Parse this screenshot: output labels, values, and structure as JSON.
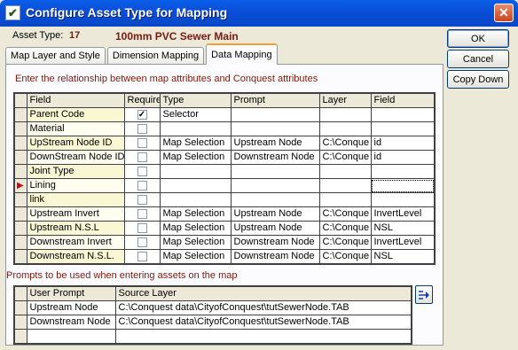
{
  "window": {
    "title": "Configure Asset Type for Mapping",
    "close_glyph": "✕",
    "icon": "checkmark-app-icon"
  },
  "asset": {
    "label": "Asset Type:",
    "code": "17",
    "name": "100mm PVC Sewer Main"
  },
  "tabs": [
    {
      "label": "Map Layer and Style",
      "active": false
    },
    {
      "label": "Dimension Mapping",
      "active": false
    },
    {
      "label": "Data Mapping",
      "active": true
    }
  ],
  "mapping_section": {
    "heading": "Enter the relationship between map attributes and Conquest attributes",
    "columns": [
      "Field",
      "Require",
      "Type",
      "Prompt",
      "Layer",
      "Field"
    ],
    "rows": [
      {
        "field": "Parent Code",
        "required": true,
        "type": "Selector",
        "prompt": "",
        "layer": "",
        "map_field": ""
      },
      {
        "field": "Material",
        "required": false,
        "type": "",
        "prompt": "",
        "layer": "",
        "map_field": ""
      },
      {
        "field": "UpStream Node ID",
        "required": false,
        "type": "Map Selection",
        "prompt": "Upstream Node",
        "layer": "C:\\Conque",
        "map_field": "id"
      },
      {
        "field": "DownStream Node ID",
        "required": false,
        "type": "Map Selection",
        "prompt": "Downstream Node",
        "layer": "C:\\Conque",
        "map_field": "id"
      },
      {
        "field": "Joint Type",
        "required": false,
        "type": "",
        "prompt": "",
        "layer": "",
        "map_field": ""
      },
      {
        "field": "Lining",
        "required": false,
        "type": "",
        "prompt": "",
        "layer": "",
        "map_field": "",
        "current": true
      },
      {
        "field": "link",
        "required": false,
        "type": "",
        "prompt": "",
        "layer": "",
        "map_field": ""
      },
      {
        "field": "Upstream Invert",
        "required": false,
        "type": "Map Selection",
        "prompt": "Upstream Node",
        "layer": "C:\\Conque",
        "map_field": "InvertLevel"
      },
      {
        "field": "Upstream N.S.L",
        "required": false,
        "type": "Map Selection",
        "prompt": "Upstream Node",
        "layer": "C:\\Conque",
        "map_field": "NSL"
      },
      {
        "field": "Downstream Invert",
        "required": false,
        "type": "Map Selection",
        "prompt": "Downstream Node",
        "layer": "C:\\Conque",
        "map_field": "InvertLevel"
      },
      {
        "field": "Downstream N.S.L.",
        "required": false,
        "type": "Map Selection",
        "prompt": "Downstream Node",
        "layer": "C:\\Conque",
        "map_field": "NSL"
      }
    ]
  },
  "prompts_section": {
    "heading": "Prompts to be used when entering assets on the map",
    "columns": [
      "User Prompt",
      "Source Layer"
    ],
    "rows": [
      {
        "prompt": "Upstream Node",
        "source": "C:\\Conquest data\\CityofConquest\\tutSewerNode.TAB"
      },
      {
        "prompt": "Downstream Node",
        "source": "C:\\Conquest data\\CityofConquest\\tutSewerNode.TAB"
      },
      {
        "prompt": "",
        "source": ""
      }
    ],
    "side_button_icon": "insert-arrow-icon"
  },
  "buttons": {
    "ok": "OK",
    "cancel": "Cancel",
    "copy_down": "Copy Down"
  },
  "colors": {
    "title_bar": "#0a4fd9",
    "accent_text": "#7a1a10",
    "row_band": "#f9f7d4",
    "tab_highlight": "#f1a134"
  }
}
